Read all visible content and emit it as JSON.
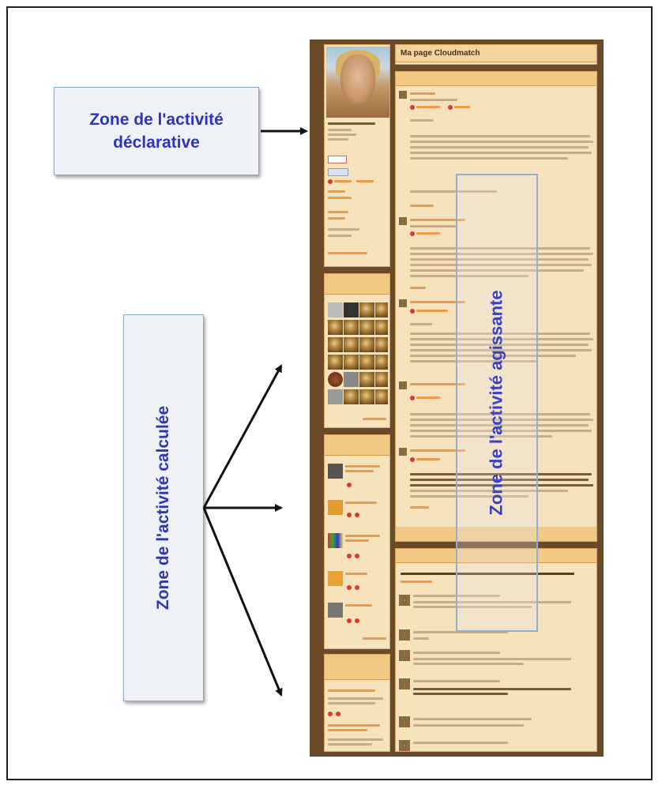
{
  "labels": {
    "declarative": "Zone de l'activité déclarative",
    "calculated": "Zone de l'activité calculée",
    "acting": "Zone de l'activité agissante"
  },
  "screenshot": {
    "page_title": "Ma page Cl​oudmatch"
  },
  "colors": {
    "label_text": "#2f35b8",
    "box_border": "#8ba8c8",
    "page_bg": "#f6e2bb",
    "header_bg": "#f3c884",
    "frame_brown": "#6b4a2a",
    "link_orange": "#ee9a49"
  }
}
